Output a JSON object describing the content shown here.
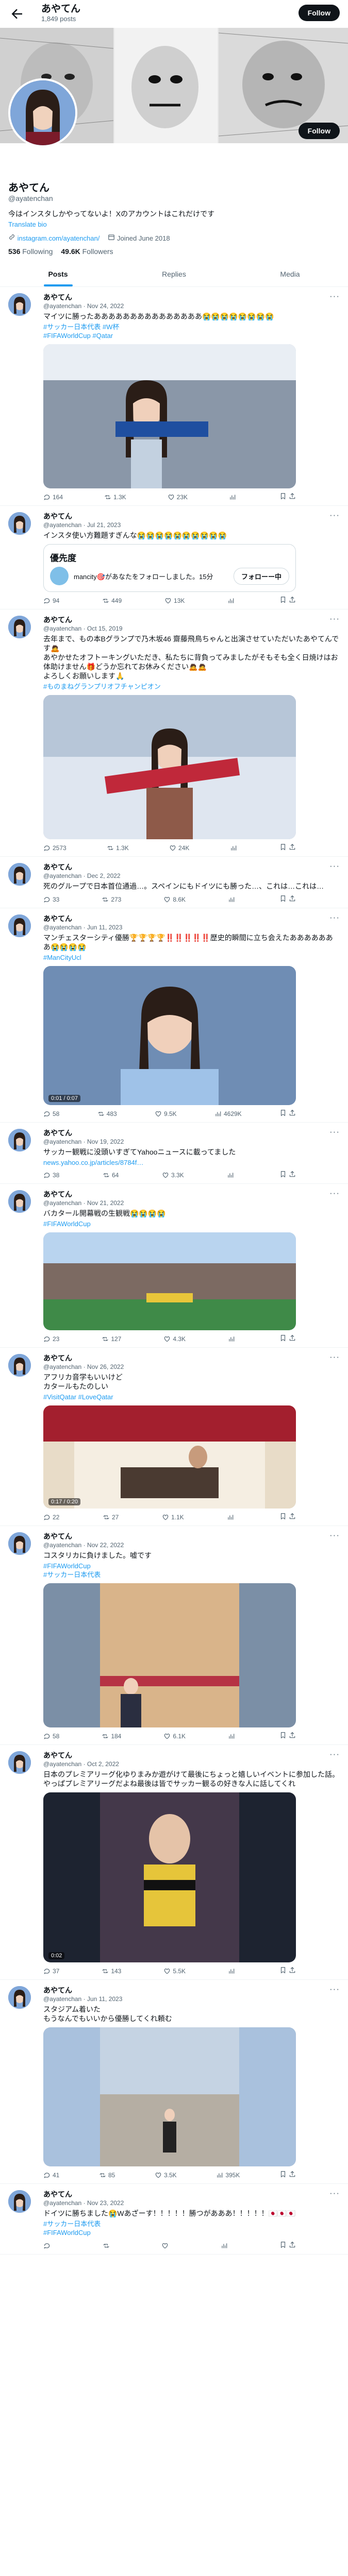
{
  "header": {
    "name": "あやてん",
    "posts": "1,849 posts",
    "follow": "Follow"
  },
  "profile": {
    "name": "あやてん",
    "handle": "@ayatenchan",
    "bio": "今はインスタしかやってないよ！Xのアカウントはこれだけです",
    "translate": "Translate bio",
    "link": "instagram.com/ayatenchan/",
    "joined": "Joined June 2018",
    "following_count": "536",
    "following_label": "Following",
    "followers_count": "49.6K",
    "followers_label": "Followers",
    "follow": "Follow"
  },
  "tabs": [
    {
      "label": "Posts"
    },
    {
      "label": "Replies"
    },
    {
      "label": "Media"
    }
  ],
  "tweets": [
    {
      "name": "あやてん",
      "handle": "@ayatenchan · Nov 24, 2022",
      "text": "マイツに勝ったあああああああああああああああ😭😭😭😭😭😭😭😭",
      "hashtags": "#サッカー日本代表 #W杯\n#FIFAWorldCup #Qatar",
      "stats": {
        "reply": "164",
        "retweet": "1.3K",
        "like": "23K",
        "views": ""
      }
    },
    {
      "name": "あやてん",
      "handle": "@ayatenchan · Jul 21, 2023",
      "text": "インスタ使い方難題すぎんな😭😭😭😭😭😭😭😭😭😭",
      "hashtags": "",
      "quote": {
        "title": "優先度",
        "text": "mancity🎯があなたをフォローしました。15分",
        "button": "フォローー中"
      },
      "stats": {
        "reply": "94",
        "retweet": "449",
        "like": "13K",
        "views": ""
      }
    },
    {
      "name": "あやてん",
      "handle": "@ayatenchan · Oct 15, 2019",
      "text": "去年まで、もの本Bグランプで乃木坂46 齋藤飛鳥ちゃんと出演させていただいたあやてんです🙇\nあやかせたオフトーキングいただき、私たちに背負ってみましたがそもそも全く日焼けはお体助けません🎁どうか忘れてお休みください🙇🙇\nよろしくお願いします🙏",
      "hashtags": "#ものまねグランプリオフチャンピオン",
      "stats": {
        "reply": "2573",
        "retweet": "1.3K",
        "like": "24K",
        "views": ""
      }
    },
    {
      "name": "あやてん",
      "handle": "@ayatenchan · Dec 2, 2022",
      "text": "死のグループで日本首位通過…。スペインにもドイツにも勝った…、これは…これは…",
      "hashtags": "",
      "stats": {
        "reply": "33",
        "retweet": "273",
        "like": "8.6K",
        "views": ""
      }
    },
    {
      "name": "あやてん",
      "handle": "@ayatenchan · Jun 11, 2023",
      "text": "マンチェスターシティ優勝🏆🏆🏆🏆‼️‼️‼️‼️‼️歴史的瞬間に立ち会えたあああああああ😭😭😭😭",
      "hashtags": "#ManCityUcl",
      "video_time": "0:01 / 0:07",
      "stats": {
        "reply": "58",
        "retweet": "483",
        "like": "9.5K",
        "views": "4629K"
      }
    },
    {
      "name": "あやてん",
      "handle": "@ayatenchan · Nov 19, 2022",
      "text": "サッカー観戦に没頭いすぎてYahooニュースに載ってました",
      "hashtags": "",
      "link": "news.yahoo.co.jp/articles/8784f…",
      "stats": {
        "reply": "38",
        "retweet": "64",
        "like": "3.3K",
        "views": ""
      }
    },
    {
      "name": "あやてん",
      "handle": "@ayatenchan · Nov 21, 2022",
      "text": "バカタール開幕戦の生観戦😭😭😭😭",
      "hashtags": "#FIFAWorldCup",
      "stats": {
        "reply": "23",
        "retweet": "127",
        "like": "4.3K",
        "views": ""
      }
    },
    {
      "name": "あやてん",
      "handle": "@ayatenchan · Nov 26, 2022",
      "text": "アフリカ音学もいいけど\nカタールもたのしい",
      "hashtags": "#VisitQatar #LoveQatar",
      "video_time": "0:17 / 0:20",
      "stats": {
        "reply": "22",
        "retweet": "27",
        "like": "1.1K",
        "views": ""
      }
    },
    {
      "name": "あやてん",
      "handle": "@ayatenchan · Nov 22, 2022",
      "text": "コスタリカに負けました。嘘です",
      "hashtags": "#FIFAWorldCup\n#サッカー日本代表",
      "stats": {
        "reply": "58",
        "retweet": "184",
        "like": "6.1K",
        "views": ""
      }
    },
    {
      "name": "あやてん",
      "handle": "@ayatenchan · Oct 2, 2022",
      "text": "日本のプレミアリーグ化ゆりまみか遊がけて最後にちょっと嬉しいイベントに参加した話。やっぱプレミアリーグだよね最後は皆でサッカー観るの好きな人に話してくれ",
      "hashtags": "",
      "video_time": "0:02",
      "stats": {
        "reply": "37",
        "retweet": "143",
        "like": "5.5K",
        "views": ""
      }
    },
    {
      "name": "あやてん",
      "handle": "@ayatenchan · Jun 11, 2023",
      "text": "スタジアム着いた\nもうなんでもいいから優勝してくれ頼む",
      "hashtags": "",
      "stats": {
        "reply": "41",
        "retweet": "85",
        "like": "3.5K",
        "views": "395K"
      }
    },
    {
      "name": "あやてん",
      "handle": "@ayatenchan · Nov 23, 2022",
      "text": "ドイツに勝ちました😭Wあざーす！！！！！勝つがあああ！！！！！🇯🇵🇯🇵🇯🇵",
      "hashtags": "#サッカー日本代表\n#FIFAWorldCup",
      "stats": {
        "reply": "",
        "retweet": "",
        "like": "",
        "views": ""
      }
    }
  ]
}
